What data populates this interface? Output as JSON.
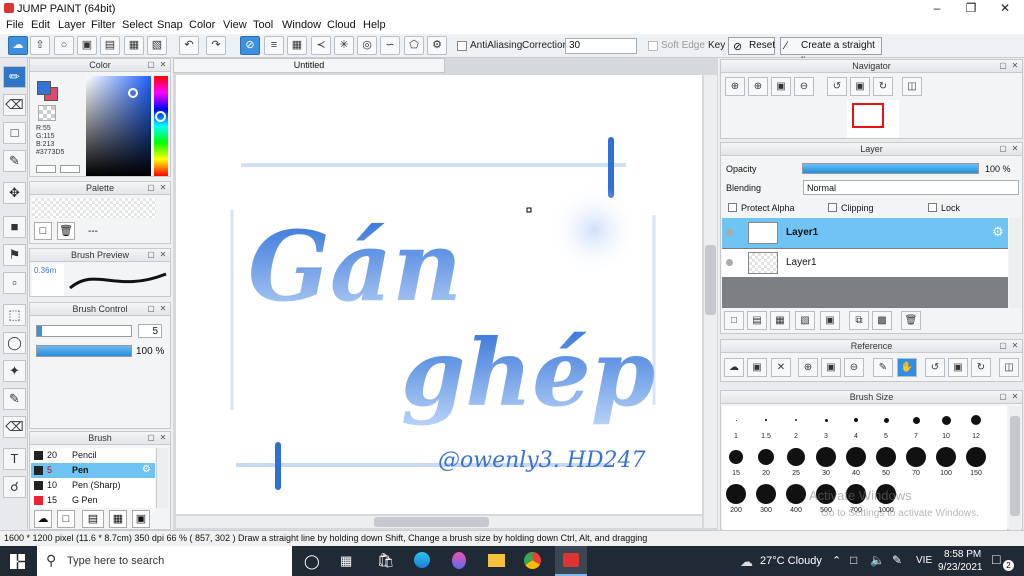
{
  "window": {
    "title": "JUMP PAINT (64bit)"
  },
  "menu": [
    "File",
    "Edit",
    "Layer",
    "Filter",
    "Select",
    "Snap",
    "Color",
    "View",
    "Tool",
    "Window",
    "Cloud",
    "Help"
  ],
  "toolbar": {
    "antialiasing_label": "AntiAliasing",
    "correction_label": "Correction",
    "correction_value": "30",
    "soft_edge_label": "Soft Edge",
    "key_label": "Key",
    "reset_label": "Reset",
    "straight_line_label": "Create a straight line"
  },
  "color_panel": {
    "title": "Color",
    "r": "R:55",
    "g": "G:115",
    "b": "B:213",
    "hex": "#3773D5",
    "fg": "#3773d5",
    "bg": "#e04a6a"
  },
  "palette_panel": {
    "title": "Palette",
    "none": "---"
  },
  "brush_preview_panel": {
    "title": "Brush Preview",
    "size": "0.36m"
  },
  "brush_control_panel": {
    "title": "Brush Control",
    "size_value": "5",
    "opacity_value": "100 %"
  },
  "brush_panel": {
    "title": "Brush",
    "items": [
      {
        "size": "20",
        "name": "Pencil",
        "color": "#222"
      },
      {
        "size": "5",
        "name": "Pen",
        "color": "#222"
      },
      {
        "size": "10",
        "name": "Pen (Sharp)",
        "color": "#222"
      },
      {
        "size": "15",
        "name": "G Pen",
        "color": "#e23"
      }
    ]
  },
  "canvas": {
    "tab": "Untitled",
    "title_line1": "Gán",
    "title_line2": "ghép",
    "signature": "@owenly3. HD247"
  },
  "navigator_panel": {
    "title": "Navigator"
  },
  "layer_panel": {
    "title": "Layer",
    "opacity_label": "Opacity",
    "opacity_value": "100 %",
    "blending_label": "Blending",
    "blending_value": "Normal",
    "protect_alpha": "Protect Alpha",
    "clipping": "Clipping",
    "lock": "Lock",
    "layers": [
      {
        "name": "Layer1",
        "selected": true
      },
      {
        "name": "Layer1",
        "selected": false
      }
    ]
  },
  "reference_panel": {
    "title": "Reference"
  },
  "brush_size_panel": {
    "title": "Brush Size",
    "sizes": [
      "1",
      "1.5",
      "2",
      "3",
      "4",
      "5",
      "7",
      "10",
      "12",
      "15",
      "20",
      "25",
      "30",
      "40",
      "50",
      "70",
      "100",
      "150",
      "200",
      "300",
      "400",
      "500",
      "700",
      "1000"
    ]
  },
  "watermark": {
    "line1": "Activate Windows",
    "line2": "Go to Settings to activate Windows."
  },
  "status": {
    "text": "1600 * 1200 pixel  (11.6 * 8.7cm)  350 dpi  66 %  ( 857, 302 )  Draw a straight line by holding down Shift, Change a brush size by holding down Ctrl, Alt, and dragging"
  },
  "taskbar": {
    "search_placeholder": "Type here to search",
    "weather": "27°C  Cloudy",
    "lang": "VIE",
    "time": "8:58 PM",
    "date": "9/23/2021",
    "notif": "2"
  }
}
